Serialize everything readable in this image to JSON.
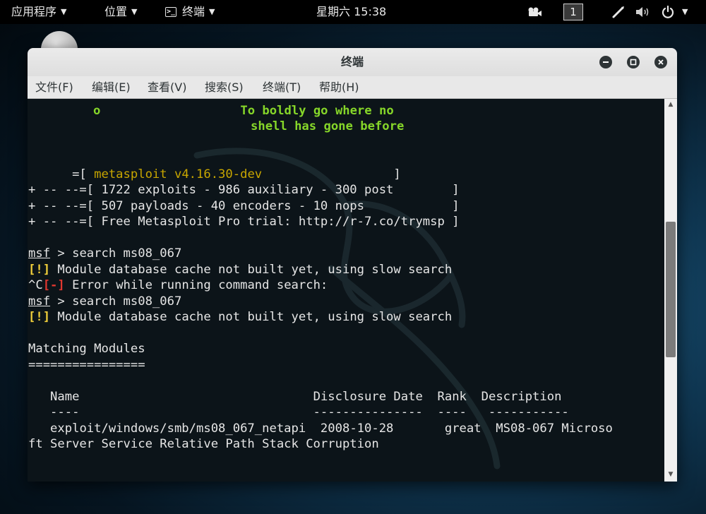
{
  "topbar": {
    "apps_label": "应用程序",
    "places_label": "位置",
    "terminal_label": "终端",
    "clock": "星期六 15:38",
    "workspace": "1",
    "caret": "▼",
    "terminal_glyph": ">_",
    "icons": [
      "camera-icon",
      "pen-icon",
      "volume-icon",
      "power-icon"
    ]
  },
  "window": {
    "title": "终端",
    "menu": [
      "文件(F)",
      "编辑(E)",
      "查看(V)",
      "搜索(S)",
      "终端(T)",
      "帮助(H)"
    ]
  },
  "terminal": {
    "banner_o": "o",
    "banner1": "To boldly go where no",
    "banner2": "shell has gone before",
    "version": "metasploit v4.16.30-dev",
    "stats1": "1722 exploits - 986 auxiliary - 300 post",
    "stats2": "507 payloads - 40 encoders - 10 nops",
    "stats3": "Free Metasploit Pro trial: http://r-7.co/trymsp",
    "prompt": "msf",
    "cmd": "search ms08_067",
    "warn_tag": "[!]",
    "warn_msg": "Module database cache not built yet, using slow search",
    "ctrl_c": "^C",
    "err_tag": "[-]",
    "err_msg": "Error while running command search:",
    "matching": "Matching Modules",
    "table": {
      "headers": [
        "Name",
        "Disclosure Date",
        "Rank",
        "Description"
      ],
      "rows": [
        {
          "name": "exploit/windows/smb/ms08_067_netapi",
          "date": "2008-10-28",
          "rank": "great",
          "desc1": "MS08-067 Microso",
          "desc2": "ft Server Service Relative Path Stack Corruption"
        }
      ]
    }
  },
  "colors": {
    "banner_green": "#86d629",
    "version_yellow": "#c8a600",
    "warn_yellow": "#f2d03b",
    "error_red": "#e0372f",
    "terminal_bg": "#0c1419"
  }
}
